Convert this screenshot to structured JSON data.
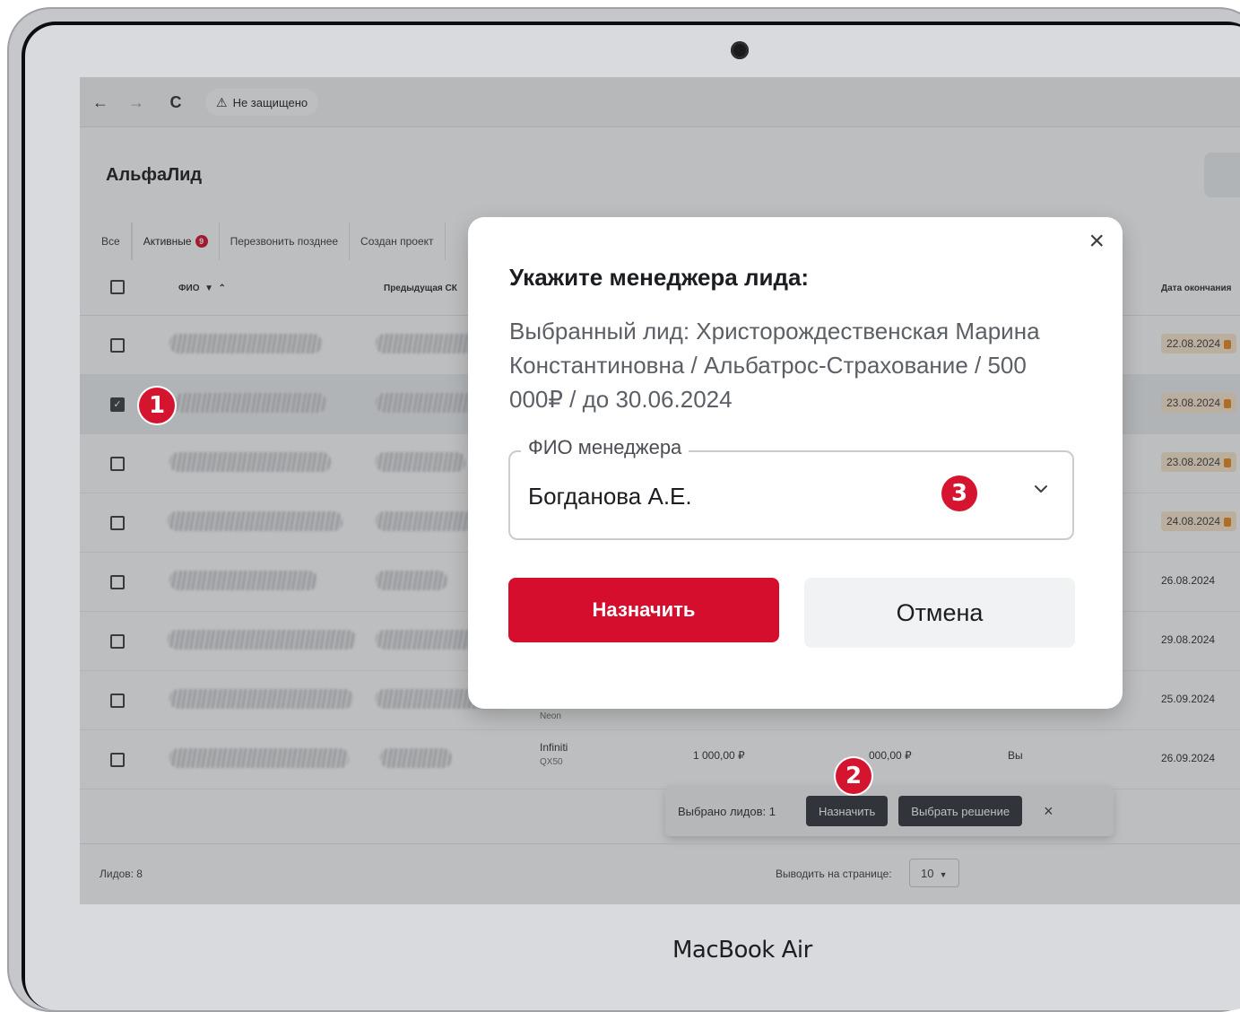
{
  "device": {
    "brand_label": "MacBook Air"
  },
  "browser": {
    "back": "←",
    "forward": "→",
    "reload": "C",
    "security_label": "Не защищено"
  },
  "app": {
    "title": "АльфаЛид",
    "tabs": [
      {
        "label": "Все"
      },
      {
        "label": "Активные",
        "badge": "9"
      },
      {
        "label": "Перезвонить позднее"
      },
      {
        "label": "Создан проект"
      }
    ],
    "columns": {
      "name": "ФИО",
      "prev_insurer": "Предыдущая СК",
      "end_date": "Дата окончания"
    },
    "rows": [
      {
        "end_date": "22.08.2024"
      },
      {
        "end_date": "23.08.2024"
      },
      {
        "end_date": "23.08.2024"
      },
      {
        "end_date": "24.08.2024"
      },
      {
        "end_date": "26.08.2024"
      },
      {
        "end_date": "29.08.2024"
      },
      {
        "car_model": "Neon",
        "end_date": "25.09.2024"
      },
      {
        "car_brand": "Infiniti",
        "car_model": "QX50",
        "amount1": "1 000,00 ₽",
        "amount2": "000,00 ₽",
        "owner": "Вы",
        "end_date": "26.09.2024"
      }
    ],
    "bulk_bar": {
      "selected_label": "Выбрано лидов: 1",
      "assign_label": "Назначить",
      "decision_label": "Выбрать решение",
      "close": "×"
    },
    "footer": {
      "total_label": "Лидов: 8",
      "per_page_label": "Выводить на странице:",
      "per_page_value": "10"
    }
  },
  "modal": {
    "close": "×",
    "title": "Укажите менеджера лида:",
    "description": "Выбранный лид: Христорождественская Марина Константиновна / Альбатрос-Страхование / 500 000₽ / до 30.06.2024",
    "manager_field": {
      "label": "ФИО менеджера",
      "value": "Богданова А.Е."
    },
    "assign_button": "Назначить",
    "cancel_button": "Отмена"
  },
  "markers": [
    "1",
    "2",
    "3"
  ],
  "colors": {
    "accent": "#d40e2c",
    "dark_button": "#31353d",
    "badge_bg": "#fbe7cf"
  }
}
